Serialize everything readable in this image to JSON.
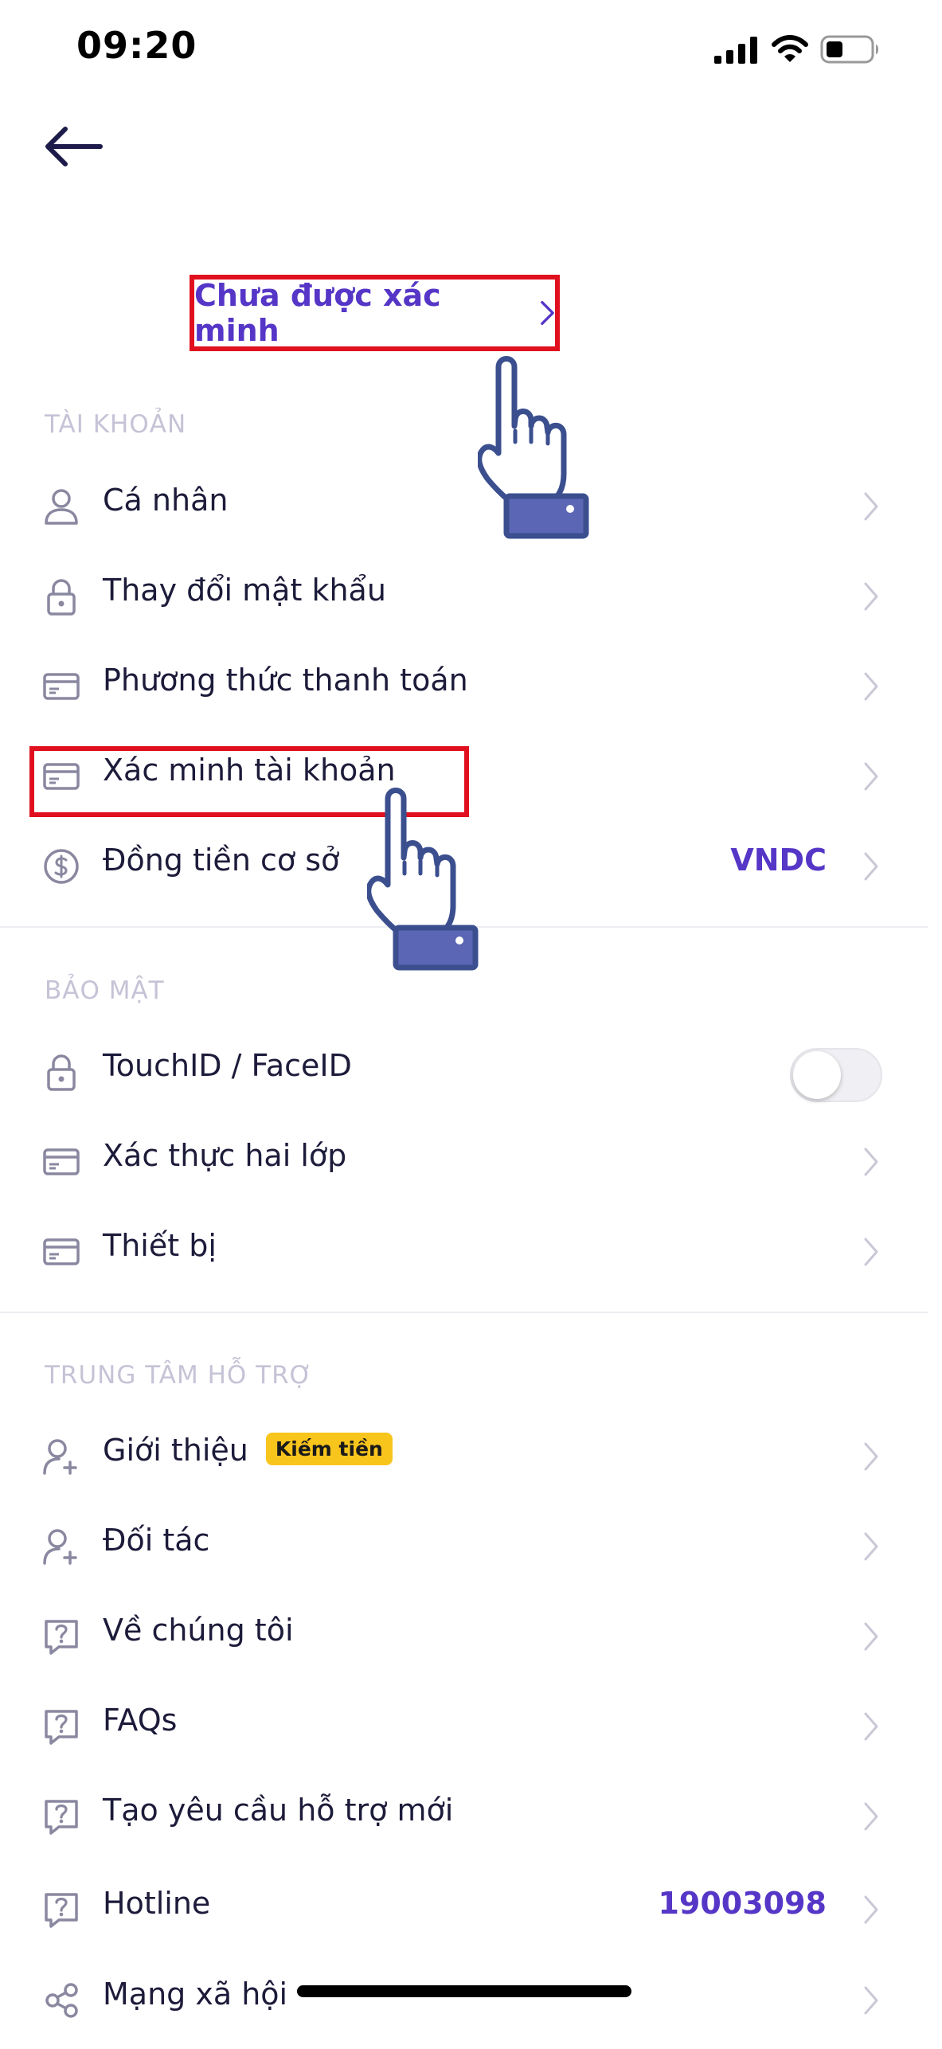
{
  "status_bar": {
    "time": "09:20"
  },
  "verification": {
    "label": "Chưa được xác minh"
  },
  "sections": {
    "account": {
      "title": "TÀI KHOẢN",
      "items": [
        {
          "label": "Cá nhân",
          "icon": "user-icon"
        },
        {
          "label": "Thay đổi mật khẩu",
          "icon": "lock-icon"
        },
        {
          "label": "Phương thức thanh toán",
          "icon": "card-icon"
        },
        {
          "label": "Xác minh tài khoản",
          "icon": "card-icon"
        },
        {
          "label": "Đồng tiền cơ sở",
          "icon": "dollar-circle-icon",
          "value": "VNDC"
        }
      ]
    },
    "security": {
      "title": "BẢO MẬT",
      "items": [
        {
          "label": "TouchID / FaceID",
          "icon": "lock-icon",
          "toggle_on": false
        },
        {
          "label": "Xác thực hai lớp",
          "icon": "card-icon"
        },
        {
          "label": "Thiết bị",
          "icon": "card-icon"
        }
      ]
    },
    "support": {
      "title": "TRUNG TÂM HỖ TRỢ",
      "items": [
        {
          "label": "Giới thiệu",
          "icon": "user-plus-icon",
          "badge": "Kiếm tiền"
        },
        {
          "label": "Đối tác",
          "icon": "user-plus-icon"
        },
        {
          "label": "Về chúng tôi",
          "icon": "help-icon"
        },
        {
          "label": "FAQs",
          "icon": "help-icon"
        },
        {
          "label": "Tạo yêu cầu hỗ trợ mới",
          "icon": "help-icon"
        },
        {
          "label": "Hotline",
          "icon": "help-icon",
          "value": "19003098"
        },
        {
          "label": "Mạng xã hội",
          "icon": "share-icon"
        }
      ]
    }
  },
  "colors": {
    "accent": "#5536c7",
    "highlight": "#e0101e",
    "badge": "#f8c51d"
  }
}
